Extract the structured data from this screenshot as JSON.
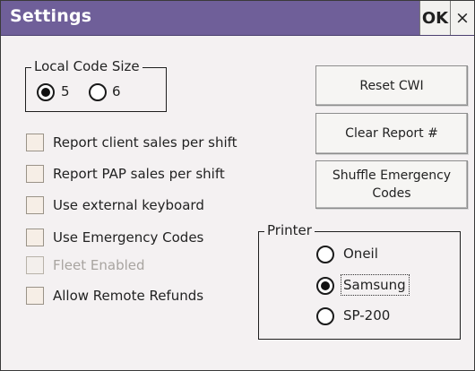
{
  "window": {
    "title": "Settings",
    "ok_label": "OK",
    "close_label": "×"
  },
  "local_code_size": {
    "legend": "Local Code Size",
    "options": [
      {
        "label": "5",
        "selected": true
      },
      {
        "label": "6",
        "selected": false
      }
    ]
  },
  "checkboxes": [
    {
      "label": "Report client sales per shift",
      "checked": false,
      "enabled": true
    },
    {
      "label": "Report PAP sales per shift",
      "checked": false,
      "enabled": true
    },
    {
      "label": "Use external keyboard",
      "checked": false,
      "enabled": true
    },
    {
      "label": "Use Emergency Codes",
      "checked": false,
      "enabled": true
    },
    {
      "label": "Fleet Enabled",
      "checked": false,
      "enabled": false
    },
    {
      "label": "Allow Remote Refunds",
      "checked": false,
      "enabled": true
    }
  ],
  "buttons": {
    "reset_cwi": "Reset CWI",
    "clear_report": "Clear Report #",
    "shuffle_line1": "Shuffle Emergency",
    "shuffle_line2": "Codes"
  },
  "printer": {
    "legend": "Printer",
    "options": [
      {
        "label": "Oneil",
        "selected": false
      },
      {
        "label": "Samsung",
        "selected": true
      },
      {
        "label": "SP-200",
        "selected": false
      }
    ]
  }
}
